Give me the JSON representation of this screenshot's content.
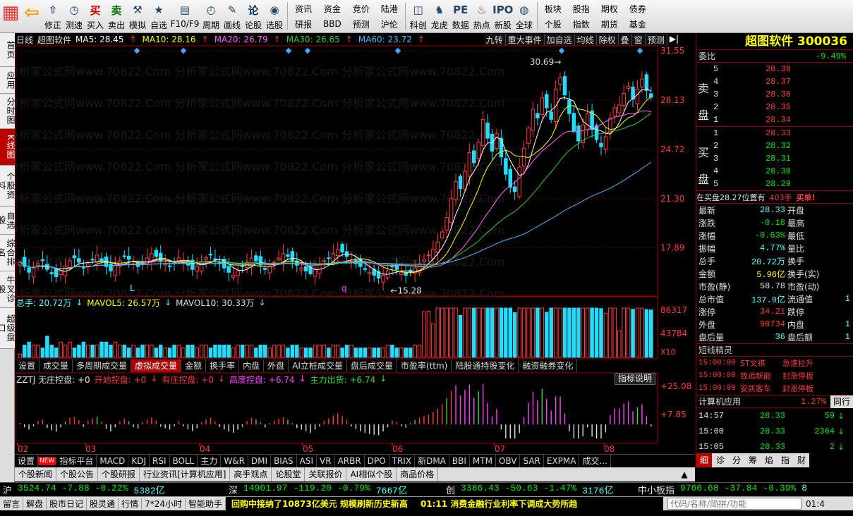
{
  "toolbar": {
    "buttons": [
      {
        "label": "",
        "icon": "windows-grid-icon"
      },
      {
        "label": "",
        "icon": "back-arrow-icon"
      },
      {
        "label": "修正",
        "icon": "up-arrow-icon"
      },
      {
        "label": "测速",
        "icon": "clock-icon"
      },
      {
        "label": "买入",
        "icon": "buy-icon",
        "glyph": "买"
      },
      {
        "label": "卖出",
        "icon": "sell-icon",
        "glyph": "卖"
      },
      {
        "label": "模拟",
        "icon": "gavel-icon"
      },
      {
        "label": "自选",
        "icon": "star-icon"
      },
      {
        "label": "F10/F9",
        "icon": "f10-icon"
      },
      {
        "label": "周期",
        "icon": "cycle-icon"
      },
      {
        "label": "画线",
        "icon": "pen-icon"
      },
      {
        "label": "论股",
        "icon": "discuss-icon",
        "glyph": "论"
      },
      {
        "label": "选股",
        "icon": "select-stock-icon"
      }
    ],
    "grid1": [
      "资讯",
      "研报",
      "资金",
      "BBD",
      "竞价",
      "预测",
      "陆港",
      "沪伦"
    ],
    "buttons2": [
      {
        "label": "科创",
        "icon": "kechuang-icon"
      },
      {
        "label": "龙虎",
        "icon": "dragon-tiger-icon"
      },
      {
        "label": "数据",
        "icon": "pe-icon"
      },
      {
        "label": "热点",
        "icon": "hot-icon"
      },
      {
        "label": "新股",
        "icon": "ipo-icon"
      },
      {
        "label": "全球",
        "icon": "globe-icon"
      }
    ],
    "grid2": [
      "板块",
      "个股",
      "股指",
      "指数",
      "期权",
      "期货",
      "债券",
      "基金"
    ]
  },
  "left_tabs": [
    {
      "label": "首页",
      "active": false
    },
    {
      "label": "应用",
      "active": false
    },
    {
      "label": "分时图",
      "active": false
    },
    {
      "label": "K线图",
      "active": true
    },
    {
      "label": "个股资料",
      "active": false
    },
    {
      "label": "自选股",
      "active": false
    },
    {
      "label": "综合排名",
      "active": false
    },
    {
      "label": "牛叉诊股",
      "active": false
    },
    {
      "label": "超级盘口",
      "active": false
    }
  ],
  "chart_header": {
    "period": "日线",
    "name": "超图软件",
    "ma": [
      {
        "label": "MA5: 28.45",
        "color": "#ffffff"
      },
      {
        "label": "MA10: 28.16",
        "color": "#ffff00"
      },
      {
        "label": "MA20: 26.79",
        "color": "#ff66ff"
      },
      {
        "label": "MA30: 26.65",
        "color": "#33cc33"
      },
      {
        "label": "MA60: 23.72",
        "color": "#44bbff"
      }
    ],
    "right_tools": [
      "九转",
      "重大事件",
      "加自选",
      "均线",
      "除权",
      "叠",
      "窗",
      "预测"
    ]
  },
  "chart_data": [
    {
      "type": "candlestick",
      "y_ticks": [
        "31.55",
        "28.13",
        "24.72",
        "21.30",
        "17.89"
      ],
      "annotations": {
        "high": "30.69",
        "low": "15.28"
      },
      "markers": [
        "L",
        "q"
      ],
      "x_labels": [
        "02",
        "03",
        "04",
        "05",
        "06",
        "07",
        "08"
      ],
      "series": {
        "close": [
          16.9,
          16.6,
          16.2,
          16.5,
          16.8,
          17.0,
          16.4,
          16.1,
          15.9,
          16.3,
          16.6,
          17.0,
          17.2,
          16.9,
          16.5,
          16.8,
          17.1,
          17.4,
          17.0,
          16.6,
          16.3,
          16.7,
          17.0,
          17.3,
          17.1,
          16.8,
          16.6,
          16.9,
          17.2,
          17.5,
          17.3,
          17.0,
          16.8,
          16.6,
          16.9,
          17.2,
          17.0,
          16.7,
          16.4,
          16.6,
          16.9,
          17.2,
          17.4,
          17.1,
          16.8,
          16.5,
          16.2,
          16.0,
          16.3,
          16.6,
          16.9,
          17.2,
          17.0,
          16.7,
          16.4,
          16.6,
          16.9,
          17.2,
          17.5,
          17.3,
          17.0,
          16.7,
          16.5,
          16.3,
          16.1,
          16.4,
          16.7,
          17.0,
          17.2,
          17.5,
          17.8,
          17.6,
          17.3,
          17.0,
          16.8,
          16.6,
          16.4,
          16.2,
          16.0,
          15.8,
          16.0,
          16.3,
          16.6,
          16.4,
          16.2,
          16.0,
          16.2,
          16.5,
          16.8,
          17.1,
          17.4,
          17.8,
          18.3,
          19.0,
          20.0,
          21.3,
          22.5,
          22.0,
          23.2,
          24.5,
          23.8,
          25.2,
          26.8,
          25.5,
          24.6,
          25.8,
          24.2,
          23.0,
          22.1,
          21.8,
          23.5,
          24.8,
          26.2,
          27.5,
          26.9,
          28.3,
          27.6,
          26.8,
          28.9,
          29.7,
          28.5,
          27.2,
          26.0,
          25.3,
          26.4,
          27.2,
          26.1,
          25.4,
          24.9,
          25.6,
          26.9,
          27.6,
          27.8,
          28.6,
          29.1,
          28.2,
          28.9,
          29.6,
          28.8,
          28.33
        ],
        "color_up": "#ff3c3c",
        "color_down": "#22ddff"
      }
    },
    {
      "type": "bar",
      "title": "总手: 20.72万",
      "mavol": [
        "MAVOL5: 26.57万",
        "MAVOL10: 30.33万"
      ],
      "y_ticks": [
        "86317",
        "43784",
        "X10"
      ]
    },
    {
      "type": "bar",
      "title": "ZZTJ 无庄控盘: +0",
      "legend": [
        {
          "label": "开始控盘: +0",
          "color": "#ff3c3c"
        },
        {
          "label": "有庄控盘: +0",
          "color": "#ff3c3c"
        },
        {
          "label": "高度控盘: +6.74",
          "color": "#ff44ff"
        },
        {
          "label": "主力出货: +6.74",
          "color": "#33dd33"
        }
      ],
      "y_ticks": [
        "+25.08",
        "+7.85"
      ],
      "button": "指标说明"
    }
  ],
  "indicator_tabs": [
    "设置",
    "成交量",
    "多周期成交量",
    "虚拟成交量",
    "金额",
    "换手率",
    "内盘",
    "外盘",
    "AI立桩成交量",
    "盘后成交量",
    "市盈率(ttm)",
    "陆股通持股变化",
    "融资融券变化"
  ],
  "indicator_active": "虚拟成交量",
  "bottom_tabs": [
    "设置",
    "NEW",
    "指标平台",
    "MACD",
    "KDJ",
    "RSI",
    "BOLL",
    "主力",
    "W&R",
    "DMI",
    "BIAS",
    "ASI",
    "VR",
    "ARBR",
    "DPO",
    "TRIX",
    "新DMA",
    "BBI",
    "MTM",
    "OBV",
    "SAR",
    "EXPMA",
    "成交..."
  ],
  "bottom_tabs2": [
    "个股新闻",
    "个股公告",
    "个股研报",
    "行业资讯[计算机应用]",
    "高手观点",
    "论股堂",
    "关联报价",
    "AI相似个股",
    "商品价格"
  ],
  "right_panel": {
    "title": "超图软件 300036",
    "weibi_label": "委比",
    "weibi": "-9.49%",
    "sell": [
      {
        "n": "5",
        "p": "28.38",
        "v": ""
      },
      {
        "n": "4",
        "p": "28.37",
        "v": ""
      },
      {
        "n": "3",
        "p": "28.36",
        "v": ""
      },
      {
        "n": "2",
        "p": "28.35",
        "v": ""
      },
      {
        "n": "1",
        "p": "28.34",
        "v": ""
      }
    ],
    "buy": [
      {
        "n": "1",
        "p": "28.33",
        "v": ""
      },
      {
        "n": "2",
        "p": "28.32",
        "v": ""
      },
      {
        "n": "3",
        "p": "28.31",
        "v": ""
      },
      {
        "n": "4",
        "p": "28.30",
        "v": ""
      },
      {
        "n": "5",
        "p": "28.29",
        "v": ""
      }
    ],
    "sell_label": "卖盘",
    "buy_label": "买盘",
    "notice_a": "在买盘28.27位置有",
    "notice_b": "403手",
    "notice_c": "买单!",
    "stats": [
      {
        "k": "最新",
        "v": "28.33",
        "c": "cy",
        "k2": "开盘",
        "v2": ""
      },
      {
        "k": "涨跌",
        "v": "-0.18",
        "c": "dn",
        "k2": "最高",
        "v2": ""
      },
      {
        "k": "涨幅",
        "v": "-0.63%",
        "c": "dn",
        "k2": "最低",
        "v2": ""
      },
      {
        "k": "振幅",
        "v": "4.77%",
        "c": "cy",
        "k2": "量比",
        "v2": ""
      },
      {
        "k": "总手",
        "v": "20.72万",
        "c": "cy",
        "k2": "换手",
        "v2": ""
      },
      {
        "k": "金额",
        "v": "5.96亿",
        "c": "yl",
        "k2": "换手(实)",
        "v2": ""
      },
      {
        "k": "市盈(静)",
        "v": "58.78",
        "c": "wt",
        "k2": "市盈(动)",
        "v2": ""
      },
      {
        "k": "总市值",
        "v": "137.9亿",
        "c": "cy",
        "k2": "流通值",
        "v2": "1"
      },
      {
        "k": "涨停",
        "v": "34.21",
        "c": "up",
        "k2": "跌停",
        "v2": ""
      },
      {
        "k": "外盘",
        "v": "98734",
        "c": "up",
        "k2": "内盘",
        "v2": "1"
      },
      {
        "k": "盘后量",
        "v": "36",
        "c": "cy",
        "k2": "盘后额",
        "v2": "1"
      }
    ],
    "short_title": "短线精灵",
    "short": [
      {
        "t": "15:00:00",
        "n": "ST文祺",
        "a": "急速拉升"
      },
      {
        "t": "15:00:00",
        "n": "致远新能",
        "a": "封涨停板"
      },
      {
        "t": "15:00:00",
        "n": "安凯客车",
        "a": "封涨停板"
      }
    ],
    "sector_name": "计算机应用",
    "sector_pct": "1.27%",
    "sector_btn": "同行",
    "ticks": [
      {
        "t": "14:57",
        "p": "28.33",
        "v": "59",
        "d": "down"
      },
      {
        "t": "15:00",
        "p": "28.33",
        "v": "2364",
        "d": "down"
      },
      {
        "t": "15:05",
        "p": "28.33",
        "v": "2",
        "d": "down"
      }
    ],
    "tabs": [
      "细",
      "诊",
      "分",
      "筹",
      "焰",
      "指",
      "财"
    ]
  },
  "indexbar": [
    {
      "name": "沪",
      "v": "3524.74",
      "d": "-7.88",
      "p": "-0.22%",
      "amt": "5382亿"
    },
    {
      "name": "深",
      "v": "14901.97",
      "d": "-119.20",
      "p": "-0.79%",
      "amt": "7667亿"
    },
    {
      "name": "创",
      "v": "3386.43",
      "d": "-50.63",
      "p": "-1.47%",
      "amt": "3176亿"
    },
    {
      "name": "中小板指",
      "v": "9766.68",
      "d": "-37.84",
      "p": "-0.39%",
      "amt": "8"
    }
  ],
  "statusbar": {
    "items": [
      "留言",
      "解盘",
      "股市日记",
      "股灵通",
      "行情",
      "7*24小时",
      "智能助手"
    ],
    "ticker": "回购中接纳了10873亿美元 规模刷新历史新高",
    "ticker2": "01:11 消费金融行业利率下调成大势所趋",
    "search_placeholder": "代码/名称/简拼/功能",
    "time": "01:4"
  }
}
